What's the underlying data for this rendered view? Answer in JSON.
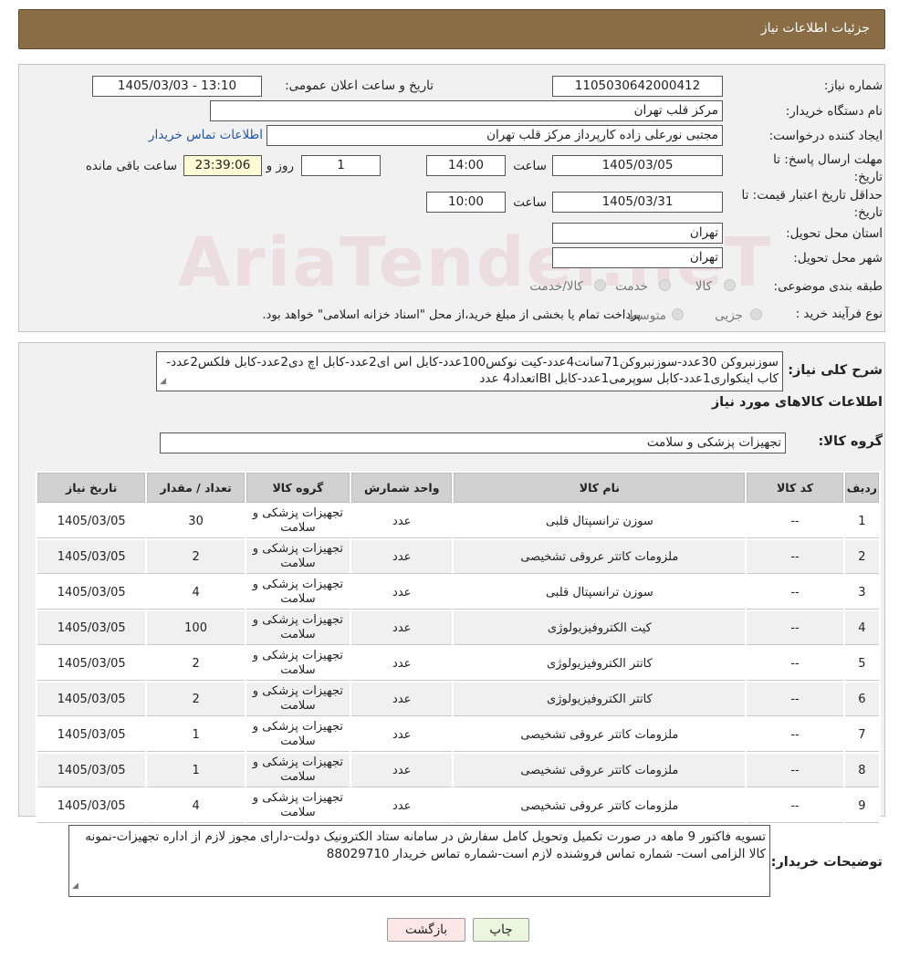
{
  "header": {
    "title": "جزئیات اطلاعات نیاز"
  },
  "form": {
    "need_number_label": "شماره نیاز:",
    "need_number": "1105030642000412",
    "announce_label": "تاریخ و ساعت اعلان عمومی:",
    "announce_value": "1405/03/03 - 13:10",
    "buyer_org_label": "نام دستگاه خریدار:",
    "buyer_org": "مرکز قلب تهران",
    "creator_label": "ایجاد کننده درخواست:",
    "creator": "مجتبی نورعلی زاده کارپرداز مرکز قلب تهران",
    "contact_link": "اطلاعات تماس خریدار",
    "deadline_label_1": "مهلت ارسال پاسخ: تا",
    "deadline_label_2": "تاریخ:",
    "deadline_date": "1405/03/05",
    "time_label": "ساعت",
    "deadline_time": "14:00",
    "days_value": "1",
    "days_label": "روز و",
    "remaining_time": "23:39:06",
    "remaining_label": "ساعت باقی مانده",
    "validity_label_1": "حداقل تاریخ اعتبار قیمت: تا",
    "validity_label_2": "تاریخ:",
    "validity_date": "1405/03/31",
    "validity_time_label": "ساعت",
    "validity_time": "10:00",
    "province_label": "استان محل تحویل:",
    "province": "تهران",
    "city_label": "شهر محل تحویل:",
    "city": "تهران",
    "category_label": "طبقه بندی موضوعی:",
    "category_options": [
      "کالا",
      "خدمت",
      "کالا/خدمت"
    ],
    "process_label": "نوع فرآیند خرید :",
    "process_options": [
      "جزیی",
      "متوسط"
    ],
    "process_note": "پرداخت تمام یا بخشی از مبلغ خرید،از محل \"اسناد خزانه اسلامی\" خواهد بود."
  },
  "description": {
    "label": "شرح کلی نیاز:",
    "text": "سوزنبروکن 30عدد-سوزنبروکن71سانت4عدد-کیت نوکس100عدد-کابل اس ای2عدد-کابل اچ دی2عدد-کابل فلکس2عدد-کاب اینکواری1عدد-کابل سوپرمی1عدد-کابل IBIتعداد4 عدد"
  },
  "goods_info_title": "اطلاعات کالاهای مورد نیاز",
  "goods_group": {
    "label": "گروه کالا:",
    "value": "تجهیزات پزشکی و سلامت"
  },
  "table": {
    "headers": [
      "ردیف",
      "کد کالا",
      "نام کالا",
      "واحد شمارش",
      "گروه کالا",
      "تعداد / مقدار",
      "تاریخ نیاز"
    ],
    "rows": [
      {
        "row": "1",
        "code": "--",
        "name": "سوزن ترانسپتال قلبی",
        "unit": "عدد",
        "group": "تجهیزات پزشکی و سلامت",
        "qty": "30",
        "date": "1405/03/05"
      },
      {
        "row": "2",
        "code": "--",
        "name": "ملزومات کاتتر عروقی تشخیصی",
        "unit": "عدد",
        "group": "تجهیزات پزشکی و سلامت",
        "qty": "2",
        "date": "1405/03/05"
      },
      {
        "row": "3",
        "code": "--",
        "name": "سوزن ترانسپتال قلبی",
        "unit": "عدد",
        "group": "تجهیزات پزشکی و سلامت",
        "qty": "4",
        "date": "1405/03/05"
      },
      {
        "row": "4",
        "code": "--",
        "name": "کیت الکتروفیزیولوژی",
        "unit": "عدد",
        "group": "تجهیزات پزشکی و سلامت",
        "qty": "100",
        "date": "1405/03/05"
      },
      {
        "row": "5",
        "code": "--",
        "name": "کاتتر الکتروفیزیولوژی",
        "unit": "عدد",
        "group": "تجهیزات پزشکی و سلامت",
        "qty": "2",
        "date": "1405/03/05"
      },
      {
        "row": "6",
        "code": "--",
        "name": "کاتتر الکتروفیزیولوژی",
        "unit": "عدد",
        "group": "تجهیزات پزشکی و سلامت",
        "qty": "2",
        "date": "1405/03/05"
      },
      {
        "row": "7",
        "code": "--",
        "name": "ملزومات کاتتر عروقی تشخیصی",
        "unit": "عدد",
        "group": "تجهیزات پزشکی و سلامت",
        "qty": "1",
        "date": "1405/03/05"
      },
      {
        "row": "8",
        "code": "--",
        "name": "ملزومات کاتتر عروقی تشخیصی",
        "unit": "عدد",
        "group": "تجهیزات پزشکی و سلامت",
        "qty": "1",
        "date": "1405/03/05"
      },
      {
        "row": "9",
        "code": "--",
        "name": "ملزومات کاتتر عروقی تشخیصی",
        "unit": "عدد",
        "group": "تجهیزات پزشکی و سلامت",
        "qty": "4",
        "date": "1405/03/05"
      }
    ]
  },
  "buyer_notes": {
    "label": "توضیحات خریدار:",
    "text": "تسویه فاکتور 9 ماهه در صورت تکمیل وتحویل کامل سفارش در سامانه  ستاد الکترونیک دولت-دارای مجوز لازم از اداره تجهیزات-نمونه کالا الزامی است- شماره تماس فروشنده لازم است-شماره تماس خریدار 88029710"
  },
  "buttons": {
    "print": "چاپ",
    "back": "بازگشت"
  },
  "watermark": "AriaTender.neT"
}
